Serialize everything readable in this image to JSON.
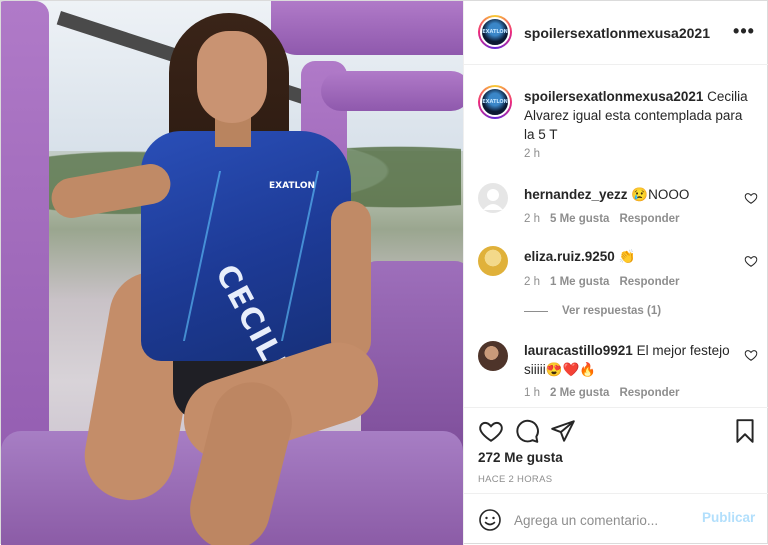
{
  "post": {
    "username": "spoilersexatlonmexusa2021",
    "avatar_text": "EXATLON",
    "photo_jersey_name": "CECILIA",
    "photo_jersey_logo": "EXATLON"
  },
  "caption": {
    "username": "spoilersexatlonmexusa2021",
    "text": " Cecilia Alvarez igual esta contemplada para la 5 T",
    "time": "2 h"
  },
  "comments": [
    {
      "username": "hernandez_yezz",
      "text": " 😢NOOO",
      "time": "2 h",
      "likes": "5 Me gusta",
      "reply": "Responder",
      "avatar_color": "#e6e6e6"
    },
    {
      "username": "eliza.ruiz.9250",
      "text": " 👏",
      "time": "2 h",
      "likes": "1 Me gusta",
      "reply": "Responder",
      "avatar_color": "#e8c24a",
      "replies_label": "Ver respuestas (1)"
    },
    {
      "username": "lauracastillo9921",
      "text": " El mejor festejo siiiii😍❤️🔥",
      "time": "1 h",
      "likes": "2 Me gusta",
      "reply": "Responder",
      "avatar_color": "#6b4a3a"
    }
  ],
  "actions": {
    "likes_count": "272 Me gusta",
    "time_ago": "HACE 2 HORAS"
  },
  "add_comment": {
    "placeholder": "Agrega un comentario...",
    "post_label": "Publicar"
  },
  "colors": {
    "link_disabled": "#b2dffc",
    "muted": "#8e8e8e",
    "text": "#262626"
  },
  "icons": [
    "more-options-icon",
    "heart-icon",
    "comment-icon",
    "share-icon",
    "bookmark-icon",
    "emoji-icon"
  ]
}
